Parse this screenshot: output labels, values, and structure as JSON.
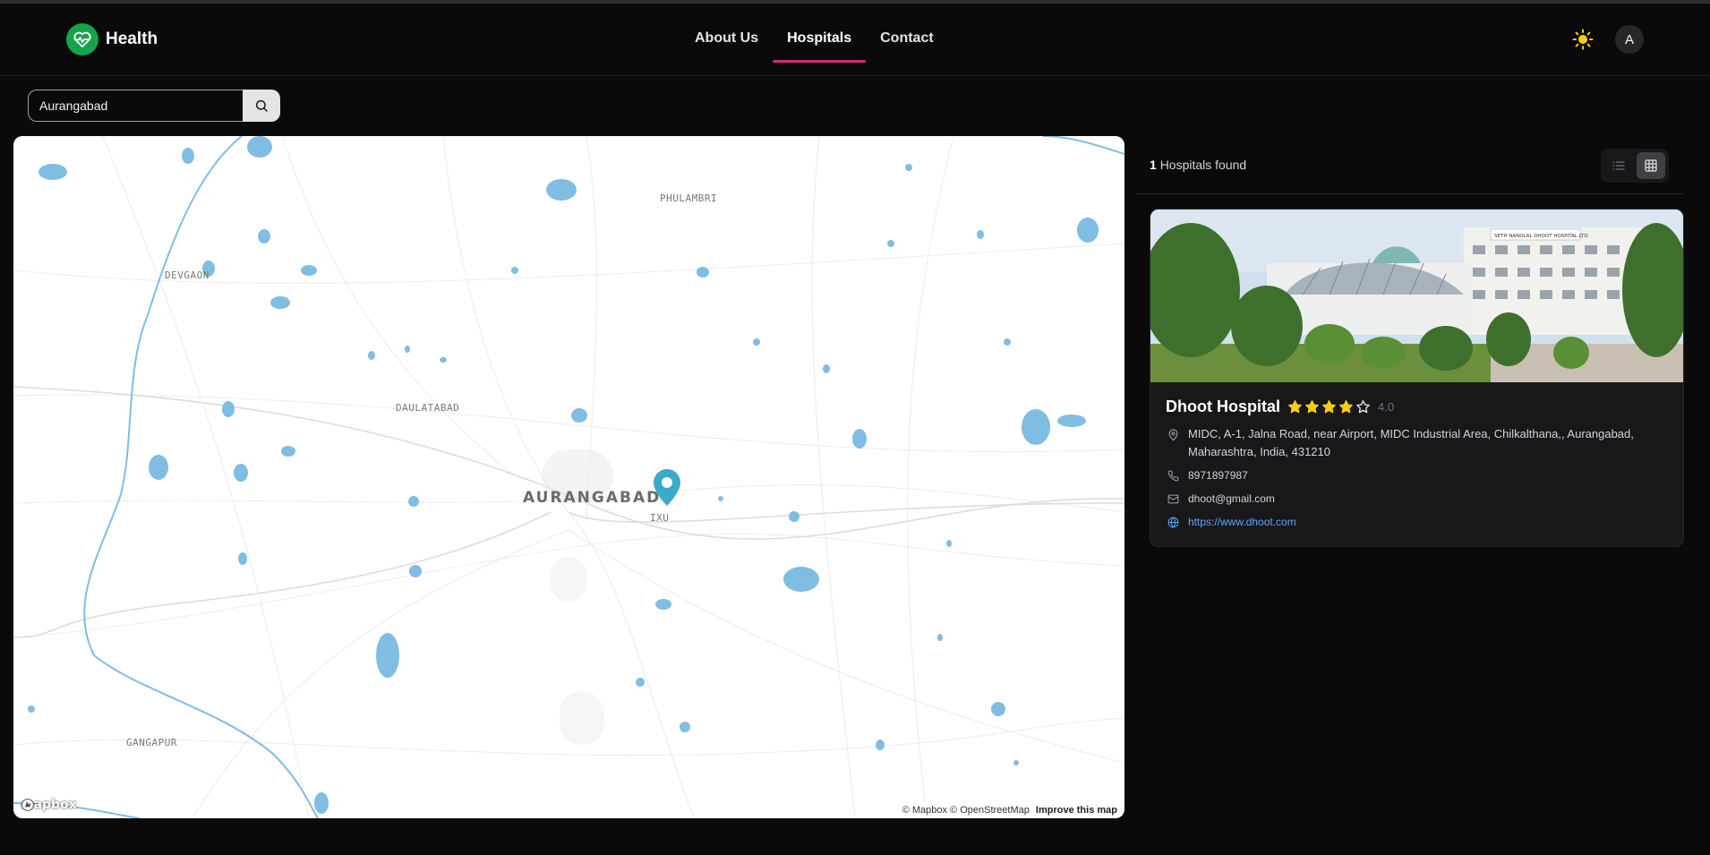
{
  "brand": {
    "name": "Health",
    "logo_icon": "heart-pulse-icon",
    "color": "#16a34a"
  },
  "nav": {
    "links": [
      {
        "label": "About Us",
        "active": false
      },
      {
        "label": "Hospitals",
        "active": true
      },
      {
        "label": "Contact",
        "active": false
      }
    ],
    "active_underline_color": "#db2777",
    "theme_icon": "sun-icon",
    "avatar_initial": "A"
  },
  "search": {
    "value": "Aurangabad",
    "icon": "search-icon"
  },
  "map": {
    "labels": {
      "phulambri": "PHULAMBRI",
      "devgaon": "DEVGAON",
      "daulatabad": "DAULATABAD",
      "aurangabad": "AURANGABAD",
      "ixu": "IXU",
      "gangapur": "GANGAPUR"
    },
    "logo_text": "mapbox",
    "attribution": "© Mapbox © OpenStreetMap",
    "improve": "Improve this map",
    "marker_color": "#3ba9c7",
    "water_color": "#80bde3"
  },
  "results": {
    "count": "1",
    "count_label": "Hospitals found",
    "view_modes": [
      "list-view-icon",
      "grid-view-icon"
    ],
    "active_view": "grid"
  },
  "hospital": {
    "name": "Dhoot Hospital",
    "rating": 4.0,
    "rating_text": "4.0",
    "max_rating": 5,
    "address": "MIDC, A-1, Jalna Road, near Airport, MIDC Industrial Area, Chilkalthana,, Aurangabad, Maharashtra, India, 431210",
    "phone": "8971897987",
    "email": "dhoot@gmail.com",
    "website": "https://www.dhoot.com",
    "sign_text": "SETH NANDLAL DHOOT HOSPITAL LTD.",
    "star_color": "#facc15"
  }
}
